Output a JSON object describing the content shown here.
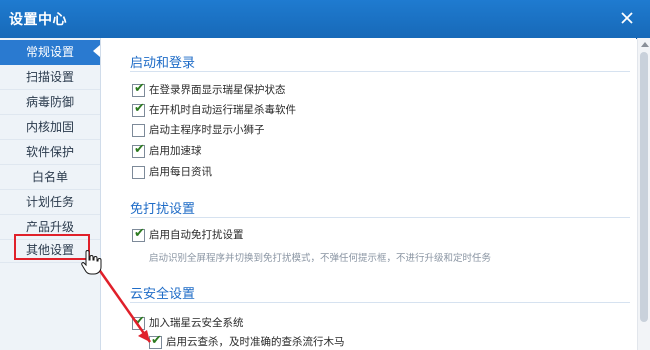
{
  "window": {
    "title": "设置中心",
    "close_icon": "close-icon"
  },
  "sidebar": {
    "items": [
      {
        "label": "常规设置",
        "active": true
      },
      {
        "label": "扫描设置",
        "active": false
      },
      {
        "label": "病毒防御",
        "active": false
      },
      {
        "label": "内核加固",
        "active": false
      },
      {
        "label": "软件保护",
        "active": false
      },
      {
        "label": "白名单",
        "active": false
      },
      {
        "label": "计划任务",
        "active": false
      },
      {
        "label": "产品升级",
        "active": false
      },
      {
        "label": "其他设置",
        "active": false
      }
    ]
  },
  "sections": {
    "startup": {
      "title": "启动和登录",
      "options": [
        {
          "label": "在登录界面显示瑞星保护状态",
          "checked": true
        },
        {
          "label": "在开机时自动运行瑞星杀毒软件",
          "checked": true
        },
        {
          "label": "启动主程序时显示小狮子",
          "checked": false
        },
        {
          "label": "启用加速球",
          "checked": true
        },
        {
          "label": "启用每日资讯",
          "checked": false
        }
      ]
    },
    "disturb": {
      "title": "免打扰设置",
      "options": [
        {
          "label": "启用自动免打扰设置",
          "checked": true
        }
      ],
      "note": "启动识别全屏程序并切换到免打扰模式，不弹任何提示框，不进行升级和定时任务"
    },
    "cloud": {
      "title": "云安全设置",
      "options": [
        {
          "label": "加入瑞星云安全系统",
          "checked": true
        },
        {
          "label": "启用云查杀，及时准确的查杀流行木马",
          "checked": true
        }
      ]
    }
  },
  "annotation": {
    "highlight_color": "#e0202a",
    "cursor_icon": "hand-cursor-icon"
  },
  "colors": {
    "titlebar": "#1769b8",
    "accent": "#2a7ad0",
    "section_title": "#1f6cc7"
  }
}
